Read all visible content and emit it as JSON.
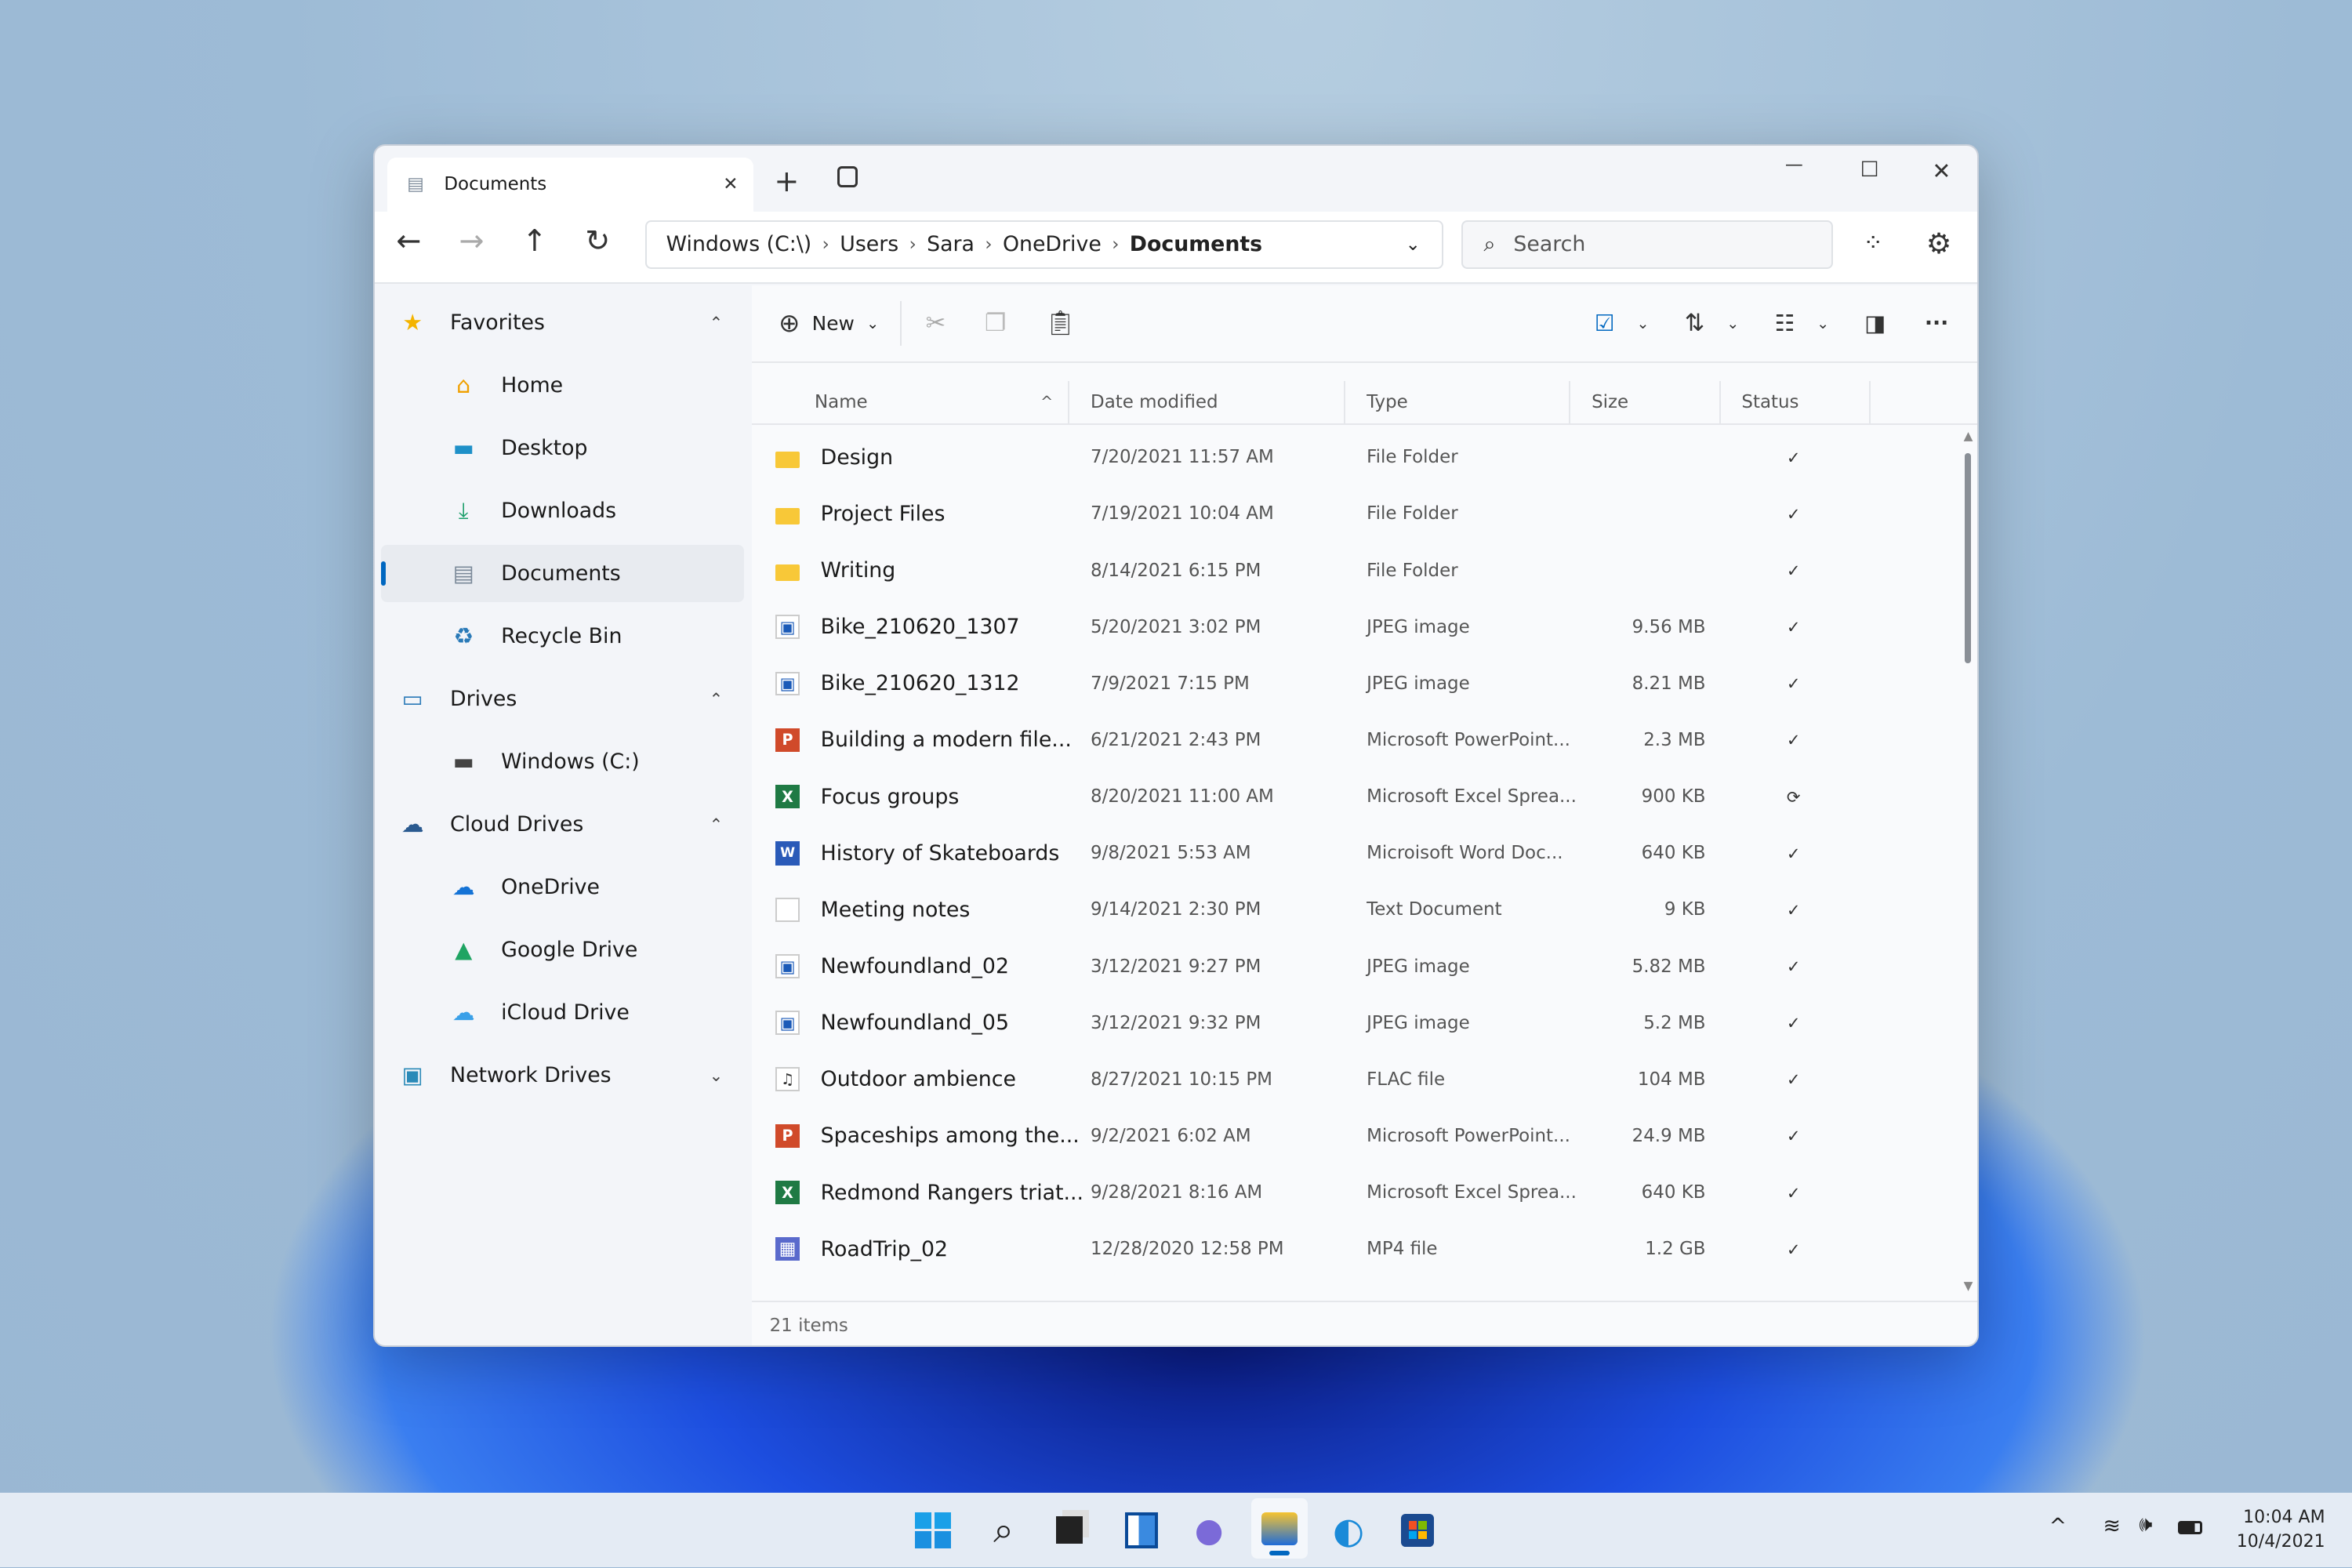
{
  "tab": {
    "title": "Documents",
    "close": "✕",
    "new_tab": "+"
  },
  "window_controls": {
    "minimize": "—",
    "maximize": "☐",
    "close": "✕"
  },
  "nav": {
    "back": "←",
    "forward": "→",
    "up": "↑",
    "refresh": "↻"
  },
  "breadcrumb": [
    "Windows (C:\\)",
    "Users",
    "Sara",
    "OneDrive",
    "Documents"
  ],
  "search": {
    "placeholder": "Search"
  },
  "sidebar": {
    "items": [
      {
        "label": "Favorites",
        "level": 0,
        "icon": "star-icon",
        "glyph": "★",
        "color": "#f4b400",
        "chevron": "^"
      },
      {
        "label": "Home",
        "level": 1,
        "icon": "home-icon",
        "glyph": "⌂",
        "color": "#f0a000"
      },
      {
        "label": "Desktop",
        "level": 1,
        "icon": "desktop-icon",
        "glyph": "▬",
        "color": "#1e90c8"
      },
      {
        "label": "Downloads",
        "level": 1,
        "icon": "download-icon",
        "glyph": "⤓",
        "color": "#1a9e6a"
      },
      {
        "label": "Documents",
        "level": 1,
        "icon": "document-icon",
        "glyph": "▤",
        "color": "#7a8898",
        "selected": true
      },
      {
        "label": "Recycle Bin",
        "level": 1,
        "icon": "recycle-bin-icon",
        "glyph": "♻",
        "color": "#2a7ab8"
      },
      {
        "label": "Drives",
        "level": 0,
        "icon": "monitor-icon",
        "glyph": "▭",
        "color": "#2a7ab8",
        "chevron": "^"
      },
      {
        "label": "Windows (C:)",
        "level": 1,
        "icon": "drive-icon",
        "glyph": "▬",
        "color": "#444"
      },
      {
        "label": "Cloud Drives",
        "level": 0,
        "icon": "cloud-drive-icon",
        "glyph": "☁",
        "color": "#2a5a90",
        "chevron": "^"
      },
      {
        "label": "OneDrive",
        "level": 1,
        "icon": "onedrive-icon",
        "glyph": "☁",
        "color": "#1473d6"
      },
      {
        "label": "Google Drive",
        "level": 1,
        "icon": "google-drive-icon",
        "glyph": "▲",
        "color": "#1fa463"
      },
      {
        "label": "iCloud Drive",
        "level": 1,
        "icon": "icloud-icon",
        "glyph": "☁",
        "color": "#3aa0e8"
      },
      {
        "label": "Network Drives",
        "level": 0,
        "icon": "network-drive-icon",
        "glyph": "▣",
        "color": "#2a8ab8",
        "chevron": "v"
      }
    ]
  },
  "toolbar": {
    "new_label": "New",
    "more": "···"
  },
  "columns": [
    "Name",
    "Date modified",
    "Type",
    "Size",
    "Status"
  ],
  "files": [
    {
      "name": "Design",
      "date": "7/20/2021  11:57 AM",
      "type": "File Folder",
      "size": "",
      "status": "synced",
      "kind": "folder"
    },
    {
      "name": "Project Files",
      "date": "7/19/2021  10:04 AM",
      "type": "File Folder",
      "size": "",
      "status": "synced",
      "kind": "folder"
    },
    {
      "name": "Writing",
      "date": "8/14/2021  6:15 PM",
      "type": "File Folder",
      "size": "",
      "status": "synced",
      "kind": "folder"
    },
    {
      "name": "Bike_210620_1307",
      "date": "5/20/2021  3:02 PM",
      "type": "JPEG image",
      "size": "9.56 MB",
      "status": "synced",
      "kind": "image"
    },
    {
      "name": "Bike_210620_1312",
      "date": "7/9/2021  7:15 PM",
      "type": "JPEG image",
      "size": "8.21 MB",
      "status": "synced",
      "kind": "image"
    },
    {
      "name": "Building a modern file...",
      "date": "6/21/2021  2:43 PM",
      "type": "Microsoft PowerPoint...",
      "size": "2.3 MB",
      "status": "synced",
      "kind": "powerpoint"
    },
    {
      "name": "Focus groups",
      "date": "8/20/2021  11:00 AM",
      "type": "Microsoft Excel Sprea...",
      "size": "900 KB",
      "status": "syncing",
      "kind": "excel"
    },
    {
      "name": "History of Skateboards",
      "date": "9/8/2021  5:53 AM",
      "type": "Microisoft Word Doc...",
      "size": "640 KB",
      "status": "synced",
      "kind": "word"
    },
    {
      "name": "Meeting notes",
      "date": "9/14/2021  2:30 PM",
      "type": "Text Document",
      "size": "9 KB",
      "status": "synced",
      "kind": "text"
    },
    {
      "name": "Newfoundland_02",
      "date": "3/12/2021  9:27 PM",
      "type": "JPEG image",
      "size": "5.82 MB",
      "status": "synced",
      "kind": "image"
    },
    {
      "name": "Newfoundland_05",
      "date": "3/12/2021  9:32 PM",
      "type": "JPEG image",
      "size": "5.2 MB",
      "status": "synced",
      "kind": "image"
    },
    {
      "name": "Outdoor ambience",
      "date": "8/27/2021  10:15 PM",
      "type": "FLAC file",
      "size": "104 MB",
      "status": "synced",
      "kind": "audio"
    },
    {
      "name": "Spaceships among the...",
      "date": "9/2/2021  6:02 AM",
      "type": "Microsoft PowerPoint...",
      "size": "24.9 MB",
      "status": "synced",
      "kind": "powerpoint"
    },
    {
      "name": "Redmond Rangers triat...",
      "date": "9/28/2021  8:16 AM",
      "type": "Microsoft Excel Sprea...",
      "size": "640 KB",
      "status": "synced",
      "kind": "excel"
    },
    {
      "name": "RoadTrip_02",
      "date": "12/28/2020  12:58 PM",
      "type": "MP4 file",
      "size": "1.2 GB",
      "status": "synced",
      "kind": "video"
    }
  ],
  "status_bar": {
    "item_count": "21 items"
  },
  "taskbar": {
    "apps": [
      "start",
      "search",
      "task-view",
      "widgets",
      "chat",
      "file-explorer",
      "edge",
      "store"
    ],
    "active": "file-explorer",
    "time": "10:04 AM",
    "date": "10/4/2021"
  },
  "colors": {
    "accent": "#0067c0",
    "folder": "#f8c838"
  }
}
